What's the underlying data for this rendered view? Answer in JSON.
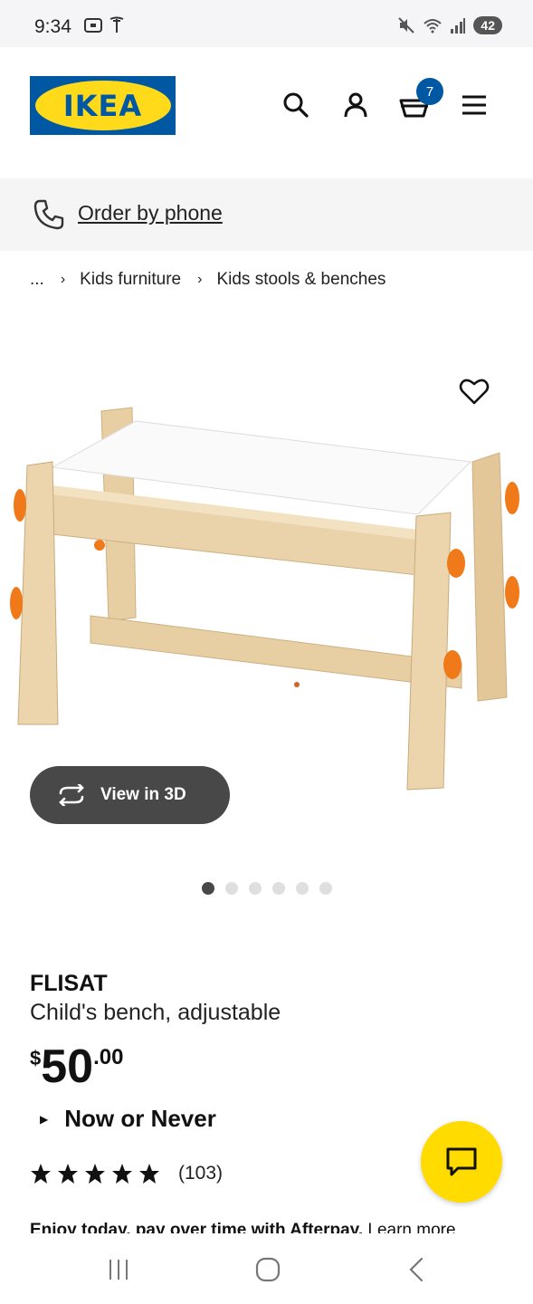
{
  "status_bar": {
    "time": "9:34",
    "battery": "42"
  },
  "header": {
    "logo_text": "IKEA",
    "cart_count": "7",
    "icons": [
      "search-icon",
      "account-icon",
      "cart-icon",
      "menu-icon"
    ]
  },
  "order_phone": {
    "label": "Order by phone"
  },
  "breadcrumb": {
    "ellipsis": "...",
    "items": [
      "Kids furniture",
      "Kids stools & benches"
    ]
  },
  "gallery": {
    "view3d_label": "View in 3D",
    "dot_count": 6,
    "active_dot": 0
  },
  "product": {
    "name": "FLISAT",
    "description": "Child's bench, adjustable",
    "price": {
      "currency": "$",
      "integer": "50",
      "decimal": ".00"
    },
    "promo": "Now or Never",
    "rating": {
      "stars": 5,
      "count": "(103)"
    },
    "afterpay_text": "Enjoy today, pay over time with Afterpay.",
    "afterpay_link": "Learn more"
  },
  "colors": {
    "ikea_blue": "#0058a3",
    "ikea_yellow": "#ffda1a",
    "chat_yellow": "#ffdb00",
    "view3d_bg": "#484848"
  }
}
